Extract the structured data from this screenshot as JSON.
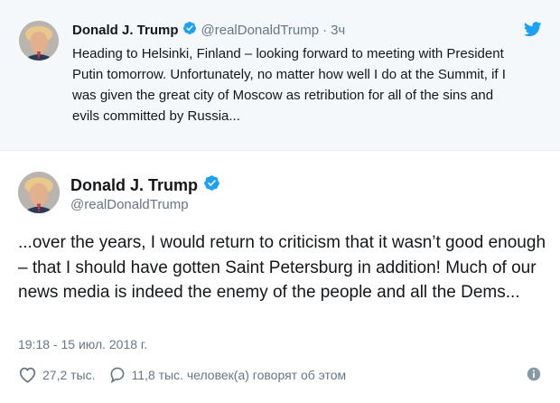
{
  "parent_tweet": {
    "name": "Donald J. Trump",
    "handle": "@realDonaldTrump",
    "separator": "·",
    "time": "3ч",
    "text": "Heading to Helsinki, Finland – looking forward to meeting with President Putin tomorrow. Unfortunately, no matter how well I do at the Summit, if I was given the great city of Moscow as retribution for all of the sins and evils committed by Russia..."
  },
  "main_tweet": {
    "name": "Donald J. Trump",
    "handle": "@realDonaldTrump",
    "text": "...over the years, I would return to criticism that it wasn’t good enough – that I should have gotten Saint Petersburg in addition! Much of our news media is indeed the enemy of the people and all the Dems...",
    "timestamp": "19:18 - 15 июл. 2018 г.",
    "likes": "27,2 тыс.",
    "replies": "11,8 тыс. человек(а) говорят об этом"
  },
  "colors": {
    "verified": "#1da1f2",
    "muted_text": "#657786",
    "parent_bg": "#f5f8fa"
  },
  "icons": [
    "verified-badge-icon",
    "twitter-bird-icon",
    "heart-icon",
    "reply-bubble-icon",
    "info-icon"
  ]
}
